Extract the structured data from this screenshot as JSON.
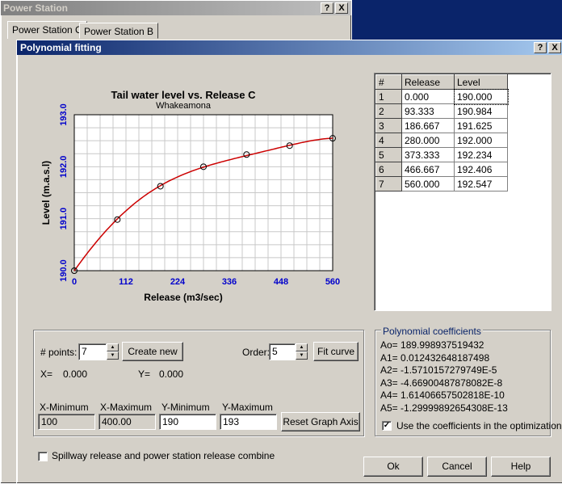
{
  "parent_window": {
    "title": "Power Station",
    "help_btn": "?",
    "close_btn": "X",
    "tabs": [
      "Power Station C",
      "Power Station B"
    ]
  },
  "dialog": {
    "title": "Polynomial fitting",
    "help_btn": "?",
    "close_btn": "X"
  },
  "chart_data": {
    "type": "line",
    "title": "Tail water level vs. Release C",
    "subtitle": "Whakeamona",
    "xlabel": "Release (m3/sec)",
    "ylabel": "Level (m.a.s.l)",
    "xlim": [
      0,
      560
    ],
    "ylim": [
      190.0,
      193.0
    ],
    "x_ticks": [
      "0",
      "112",
      "224",
      "336",
      "448",
      "560"
    ],
    "y_ticks": [
      "190.0",
      "191.0",
      "192.0",
      "193.0"
    ],
    "grid": true,
    "points": {
      "x": [
        0,
        93.333,
        186.667,
        280,
        373.333,
        466.667,
        560
      ],
      "y": [
        190.0,
        190.984,
        191.625,
        192.0,
        192.234,
        192.406,
        192.547
      ]
    },
    "fit_coefficients": [
      189.998937519432,
      0.012432648187498,
      -1.5710157279749e-05,
      -4.66900487878082e-08,
      1.61406657502818e-10,
      -1.29999892654308e-13
    ],
    "colors": {
      "curve": "#cc0000",
      "tick_labels": "#0000cc",
      "grid": "#c8c8c8"
    }
  },
  "table": {
    "headers": [
      "#",
      "Release",
      "Level"
    ],
    "rows": [
      [
        "1",
        "0.000",
        "190.000"
      ],
      [
        "2",
        "93.333",
        "190.984"
      ],
      [
        "3",
        "186.667",
        "191.625"
      ],
      [
        "4",
        "280.000",
        "192.000"
      ],
      [
        "5",
        "373.333",
        "192.234"
      ],
      [
        "6",
        "466.667",
        "192.406"
      ],
      [
        "7",
        "560.000",
        "192.547"
      ]
    ]
  },
  "controls": {
    "points_label": "# points:",
    "points_value": "7",
    "create_new": "Create new",
    "order_label": "Order:",
    "order_value": "5",
    "fit_curve": "Fit curve",
    "x_label": "X=",
    "x_value": "0.000",
    "y_label": "Y=",
    "y_value": "0.000",
    "xmin_label": "X-Minimum",
    "xmin_value": "100",
    "xmax_label": "X-Maximum",
    "xmax_value": "400.00",
    "ymin_label": "Y-Minimum",
    "ymin_value": "190",
    "ymax_label": "Y-Maximum",
    "ymax_value": "193",
    "reset_graph": "Reset Graph Axis"
  },
  "coefficients": {
    "title": "Polynomial coefficients",
    "lines": [
      "Ao= 189.998937519432",
      "A1= 0.012432648187498",
      "A2= -1.5710157279749E-5",
      "A3= -4.66900487878082E-8",
      "A4= 1.61406657502818E-10",
      "A5= -1.29999892654308E-13"
    ],
    "use_coeffs": "Use the coefficients in the optimization",
    "use_coeffs_checked": true
  },
  "spillway_label": "Spillway release and power station release combine",
  "buttons": {
    "ok": "Ok",
    "cancel": "Cancel",
    "help": "Help"
  }
}
